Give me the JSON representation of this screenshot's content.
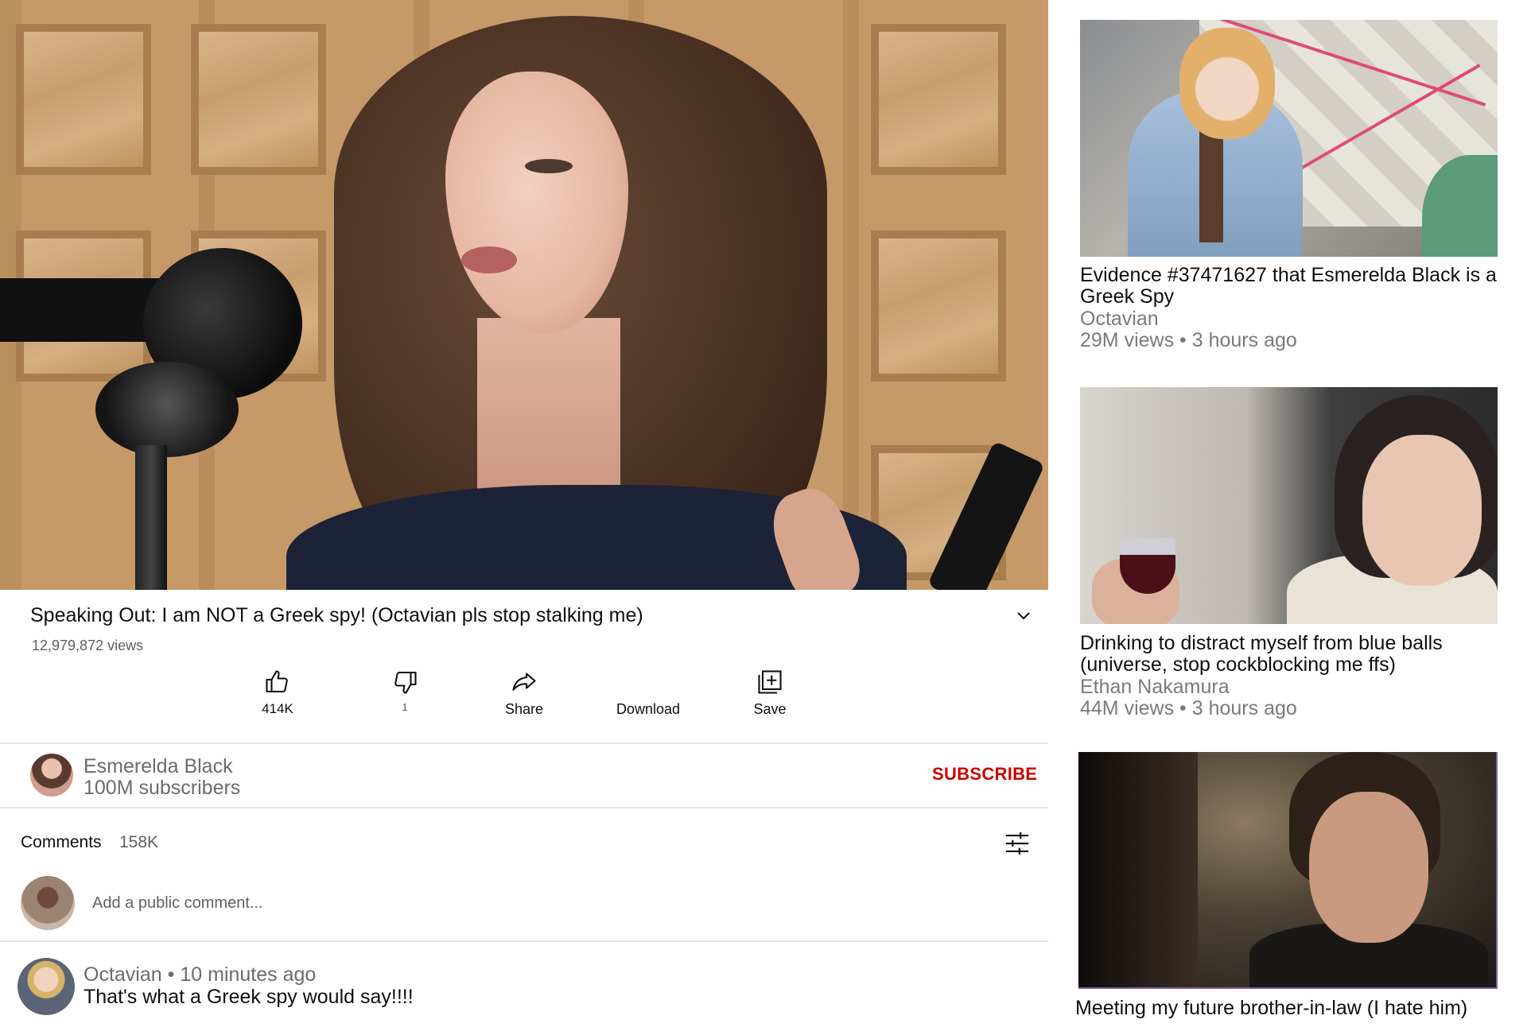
{
  "video": {
    "title": "Speaking Out: I am NOT a Greek spy! (Octavian pls stop stalking me)",
    "views": "12,979,872 views",
    "actions": {
      "like_count": "414K",
      "dislike_count": "1",
      "share_label": "Share",
      "download_label": "Download",
      "save_label": "Save"
    }
  },
  "channel": {
    "name": "Esmerelda Black",
    "subscribers": "100M subscribers",
    "subscribe_label": "SUBSCRIBE"
  },
  "comments": {
    "label": "Comments",
    "count": "158K",
    "add_placeholder": "Add a public comment...",
    "items": [
      {
        "author": "Octavian",
        "time": "10 minutes ago",
        "text": "That's what a Greek spy would say!!!!"
      }
    ]
  },
  "recommendations": [
    {
      "title": "Evidence #37471627 that Esmerelda Black is a Greek Spy",
      "channel": "Octavian",
      "views": "29M views",
      "time": "3 hours ago"
    },
    {
      "title": "Drinking to distract myself from blue balls (universe, stop cockblocking me ffs)",
      "channel": "Ethan Nakamura",
      "views": "44M views",
      "time": "3 hours ago"
    },
    {
      "title": "Meeting my future brother-in-law (I hate him)"
    }
  ],
  "icons": {
    "like": "thumbs-up-icon",
    "dislike": "thumbs-down-icon",
    "share": "share-arrow-icon",
    "save": "add-to-playlist-icon",
    "expand": "chevron-down-icon",
    "sort": "sort-sliders-icon"
  },
  "colors": {
    "subscribe": "#cc0000",
    "secondary_text": "#606060",
    "divider": "#e5e5e5"
  }
}
